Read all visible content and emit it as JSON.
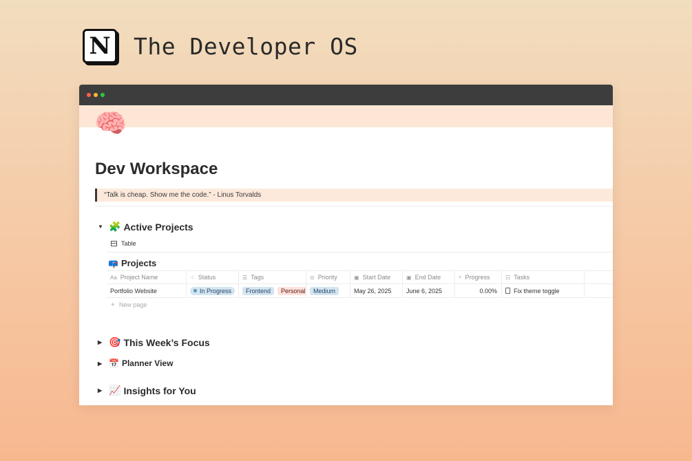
{
  "brand": {
    "logo_letter": "N",
    "title": "The Developer OS"
  },
  "page": {
    "icon": "🧠",
    "title": "Dev Workspace",
    "quote": "“Talk is cheap. Show me the code.” - Linus Torvalds"
  },
  "sections": {
    "active_projects": {
      "emoji": "🧩",
      "label": "Active Projects"
    },
    "this_week": {
      "emoji": "🎯",
      "label": "This Week’s Focus"
    },
    "planner": {
      "emoji": "📅",
      "label": "Planner View"
    },
    "insights": {
      "emoji": "📈",
      "label": "Insights for You"
    }
  },
  "view_tab": {
    "label": "Table",
    "icon": "table-icon"
  },
  "database": {
    "emoji": "📪",
    "title": "Projects",
    "columns": [
      {
        "icon": "Aa",
        "label": "Project Name"
      },
      {
        "icon": "⁘",
        "label": "Status"
      },
      {
        "icon": "☰",
        "label": "Tags"
      },
      {
        "icon": "⊙",
        "label": "Priority"
      },
      {
        "icon": "▣",
        "label": "Start Date"
      },
      {
        "icon": "▣",
        "label": "End Date"
      },
      {
        "icon": "⌕",
        "label": "Progress"
      },
      {
        "icon": "☷",
        "label": "Tasks"
      }
    ],
    "rows": [
      {
        "name": "Portfolio Website",
        "status": "In Progress",
        "tags": [
          "Frontend",
          "Personal"
        ],
        "priority": "Medium",
        "start_date": "May 26, 2025",
        "end_date": "June 6, 2025",
        "progress": "0.00%",
        "tasks": "Fix theme toggle"
      }
    ],
    "new_page_label": "New page"
  },
  "colors": {
    "background_top": "#f1ddbf",
    "background_bottom": "#f7b88f",
    "titlebar": "#3d3d3d",
    "cover": "#fde6d6",
    "quote_bg": "#fde9db",
    "blue_pill": "#d3e5ef",
    "red_pill": "#ffe2dd"
  }
}
